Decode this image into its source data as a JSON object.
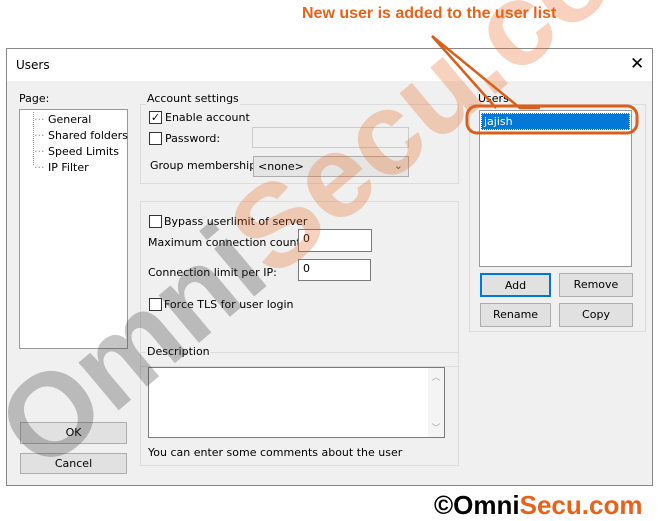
{
  "annotation": {
    "text": "New user is added to the user list",
    "color": "#e8621a"
  },
  "window": {
    "title": "Users",
    "close_icon": "close-icon"
  },
  "page_panel": {
    "label": "Page:",
    "items": [
      "General",
      "Shared folders",
      "Speed Limits",
      "IP Filter"
    ]
  },
  "account_settings": {
    "title": "Account settings",
    "enable_account": {
      "label": "Enable account",
      "checked": true
    },
    "password": {
      "label": "Password:",
      "checked": false,
      "value": ""
    },
    "group_membership": {
      "label": "Group membership:",
      "value": "<none>"
    }
  },
  "limits": {
    "bypass": {
      "label": "Bypass userlimit of server",
      "checked": false
    },
    "max_conn": {
      "label": "Maximum connection count:",
      "value": "0"
    },
    "conn_per_ip": {
      "label": "Connection limit per IP:",
      "value": "0"
    },
    "force_tls": {
      "label": "Force TLS for user login",
      "checked": false
    }
  },
  "description": {
    "title": "Description",
    "value": "",
    "help": "You can enter some comments about the user"
  },
  "users": {
    "title": "Users",
    "list": [
      "jajish"
    ],
    "selected": "jajish",
    "add": "Add",
    "remove": "Remove",
    "rename": "Rename",
    "copy": "Copy"
  },
  "footer": {
    "ok": "OK",
    "cancel": "Cancel"
  },
  "watermark": {
    "text_dark": "Omni",
    "text_accent": "Secu.com",
    "accent": "#e8621a"
  },
  "copyright": {
    "symbol": "©",
    "dark": "Omni",
    "accent": "Secu.com"
  }
}
